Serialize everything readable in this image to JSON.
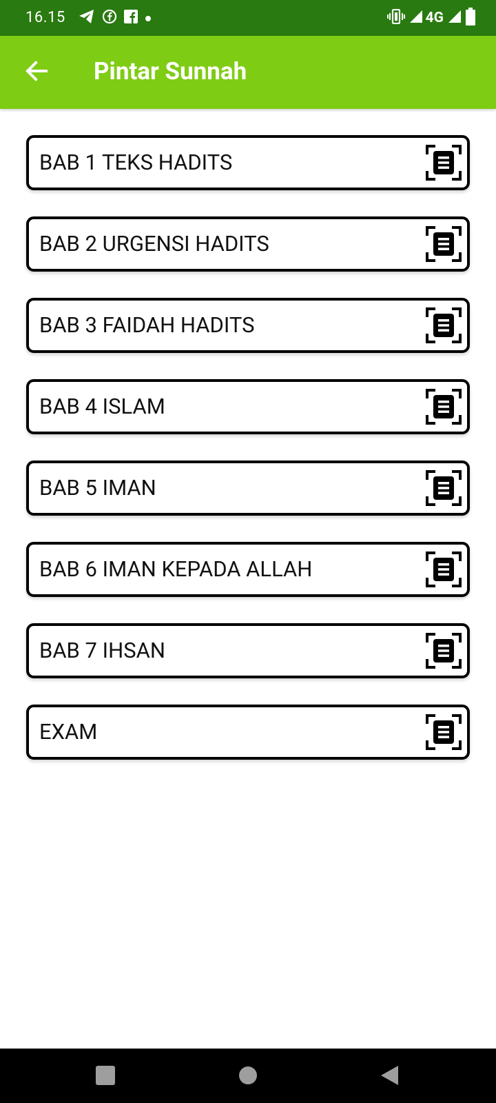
{
  "status_bar": {
    "time": "16.15",
    "network": "4G",
    "left_icons": [
      "telegram-icon",
      "facebook-messenger-icon",
      "facebook-icon",
      "dot-icon"
    ],
    "right_icons": [
      "vibrate-icon",
      "signal-icon",
      "signal-icon",
      "battery-icon"
    ]
  },
  "app_bar": {
    "title": "Pintar Sunnah",
    "back_icon": "arrow-left-icon"
  },
  "menu": {
    "items": [
      {
        "label": "BAB 1 TEKS HADITS",
        "icon": "document-scan-icon"
      },
      {
        "label": "BAB 2 URGENSI HADITS",
        "icon": "document-scan-icon"
      },
      {
        "label": "BAB 3 FAIDAH HADITS",
        "icon": "document-scan-icon"
      },
      {
        "label": "BAB 4 ISLAM",
        "icon": "document-scan-icon"
      },
      {
        "label": "BAB 5 IMAN",
        "icon": "document-scan-icon"
      },
      {
        "label": "BAB 6 IMAN KEPADA ALLAH",
        "icon": "document-scan-icon"
      },
      {
        "label": "BAB 7 IHSAN",
        "icon": "document-scan-icon"
      },
      {
        "label": "EXAM",
        "icon": "document-scan-icon"
      }
    ]
  },
  "nav_bar": {
    "buttons": [
      "recents-icon",
      "home-icon",
      "back-icon"
    ]
  },
  "colors": {
    "status_bar": "#297a10",
    "app_bar": "#7fcc14",
    "background": "#ffffff",
    "item_border": "#000000",
    "nav_bar": "#000000"
  }
}
